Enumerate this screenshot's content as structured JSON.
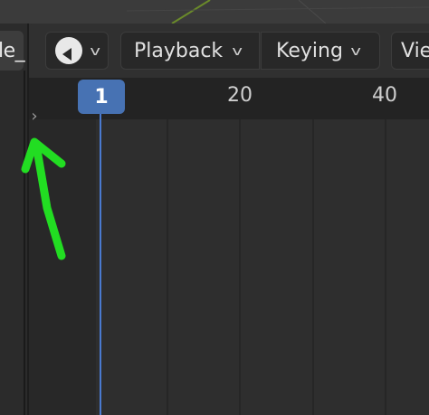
{
  "left_editor": {
    "header_label": "le_"
  },
  "timeline": {
    "header": {
      "editor_type_icon": "clock-icon",
      "playback_label": "Playback",
      "keying_label": "Keying",
      "view_label": "Vie"
    },
    "ruler": {
      "current_frame": "1",
      "frame_labels": [
        "20",
        "40"
      ]
    },
    "sidebar_toggle_icon": "chevron-right-icon"
  },
  "annotation": {
    "color": "#22dd22",
    "shape": "arrow-pointing-up"
  },
  "colors": {
    "playhead": "#4772b3",
    "background": "#303030"
  }
}
